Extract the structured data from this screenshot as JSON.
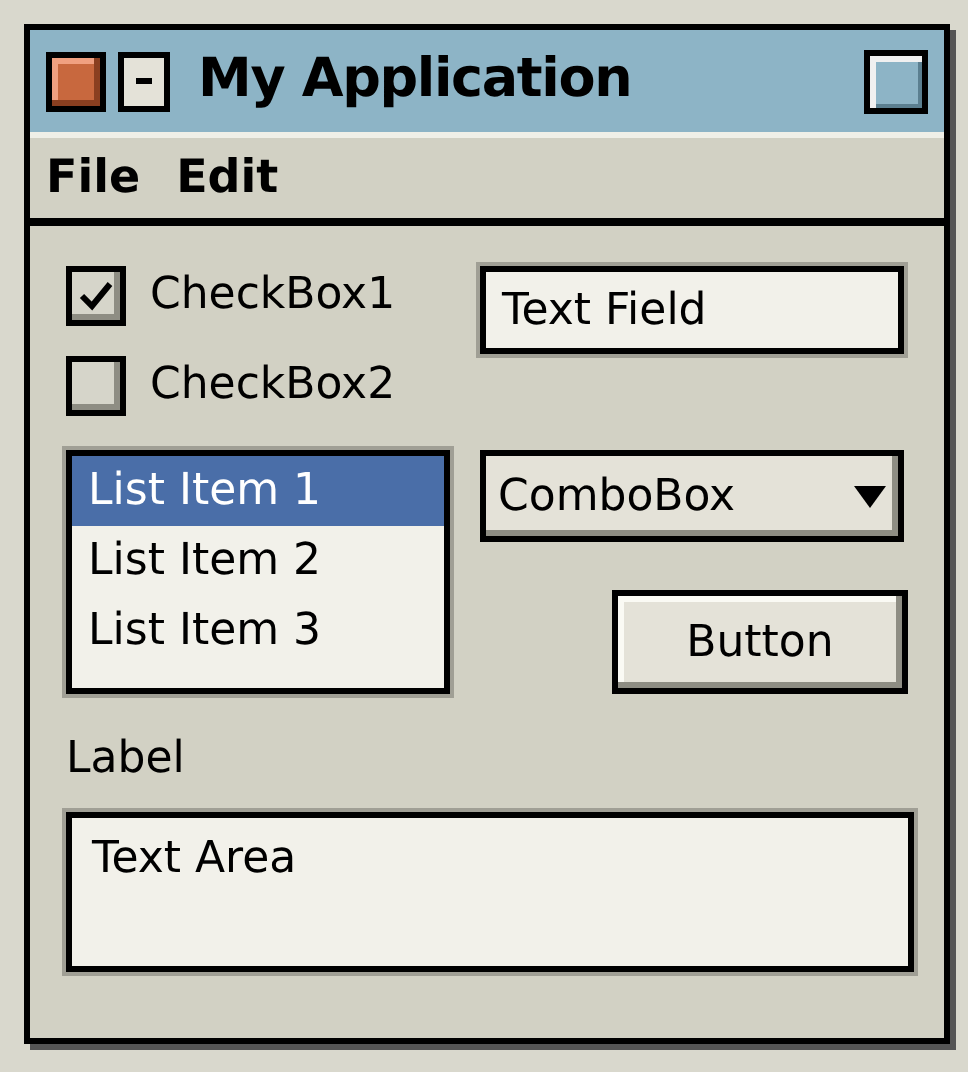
{
  "window": {
    "title": "My Application"
  },
  "menu": [
    "File",
    "Edit"
  ],
  "checkboxes": [
    {
      "label": "CheckBox1",
      "checked": true
    },
    {
      "label": "CheckBox2",
      "checked": false
    }
  ],
  "text_field": {
    "value": "Text Field"
  },
  "list": [
    {
      "label": "List Item 1",
      "selected": true
    },
    {
      "label": "List Item 2",
      "selected": false
    },
    {
      "label": "List Item 3",
      "selected": false
    }
  ],
  "combobox": {
    "value": "ComboBox"
  },
  "button": {
    "label": "Button"
  },
  "label": "Label",
  "text_area": {
    "value": "Text Area"
  }
}
